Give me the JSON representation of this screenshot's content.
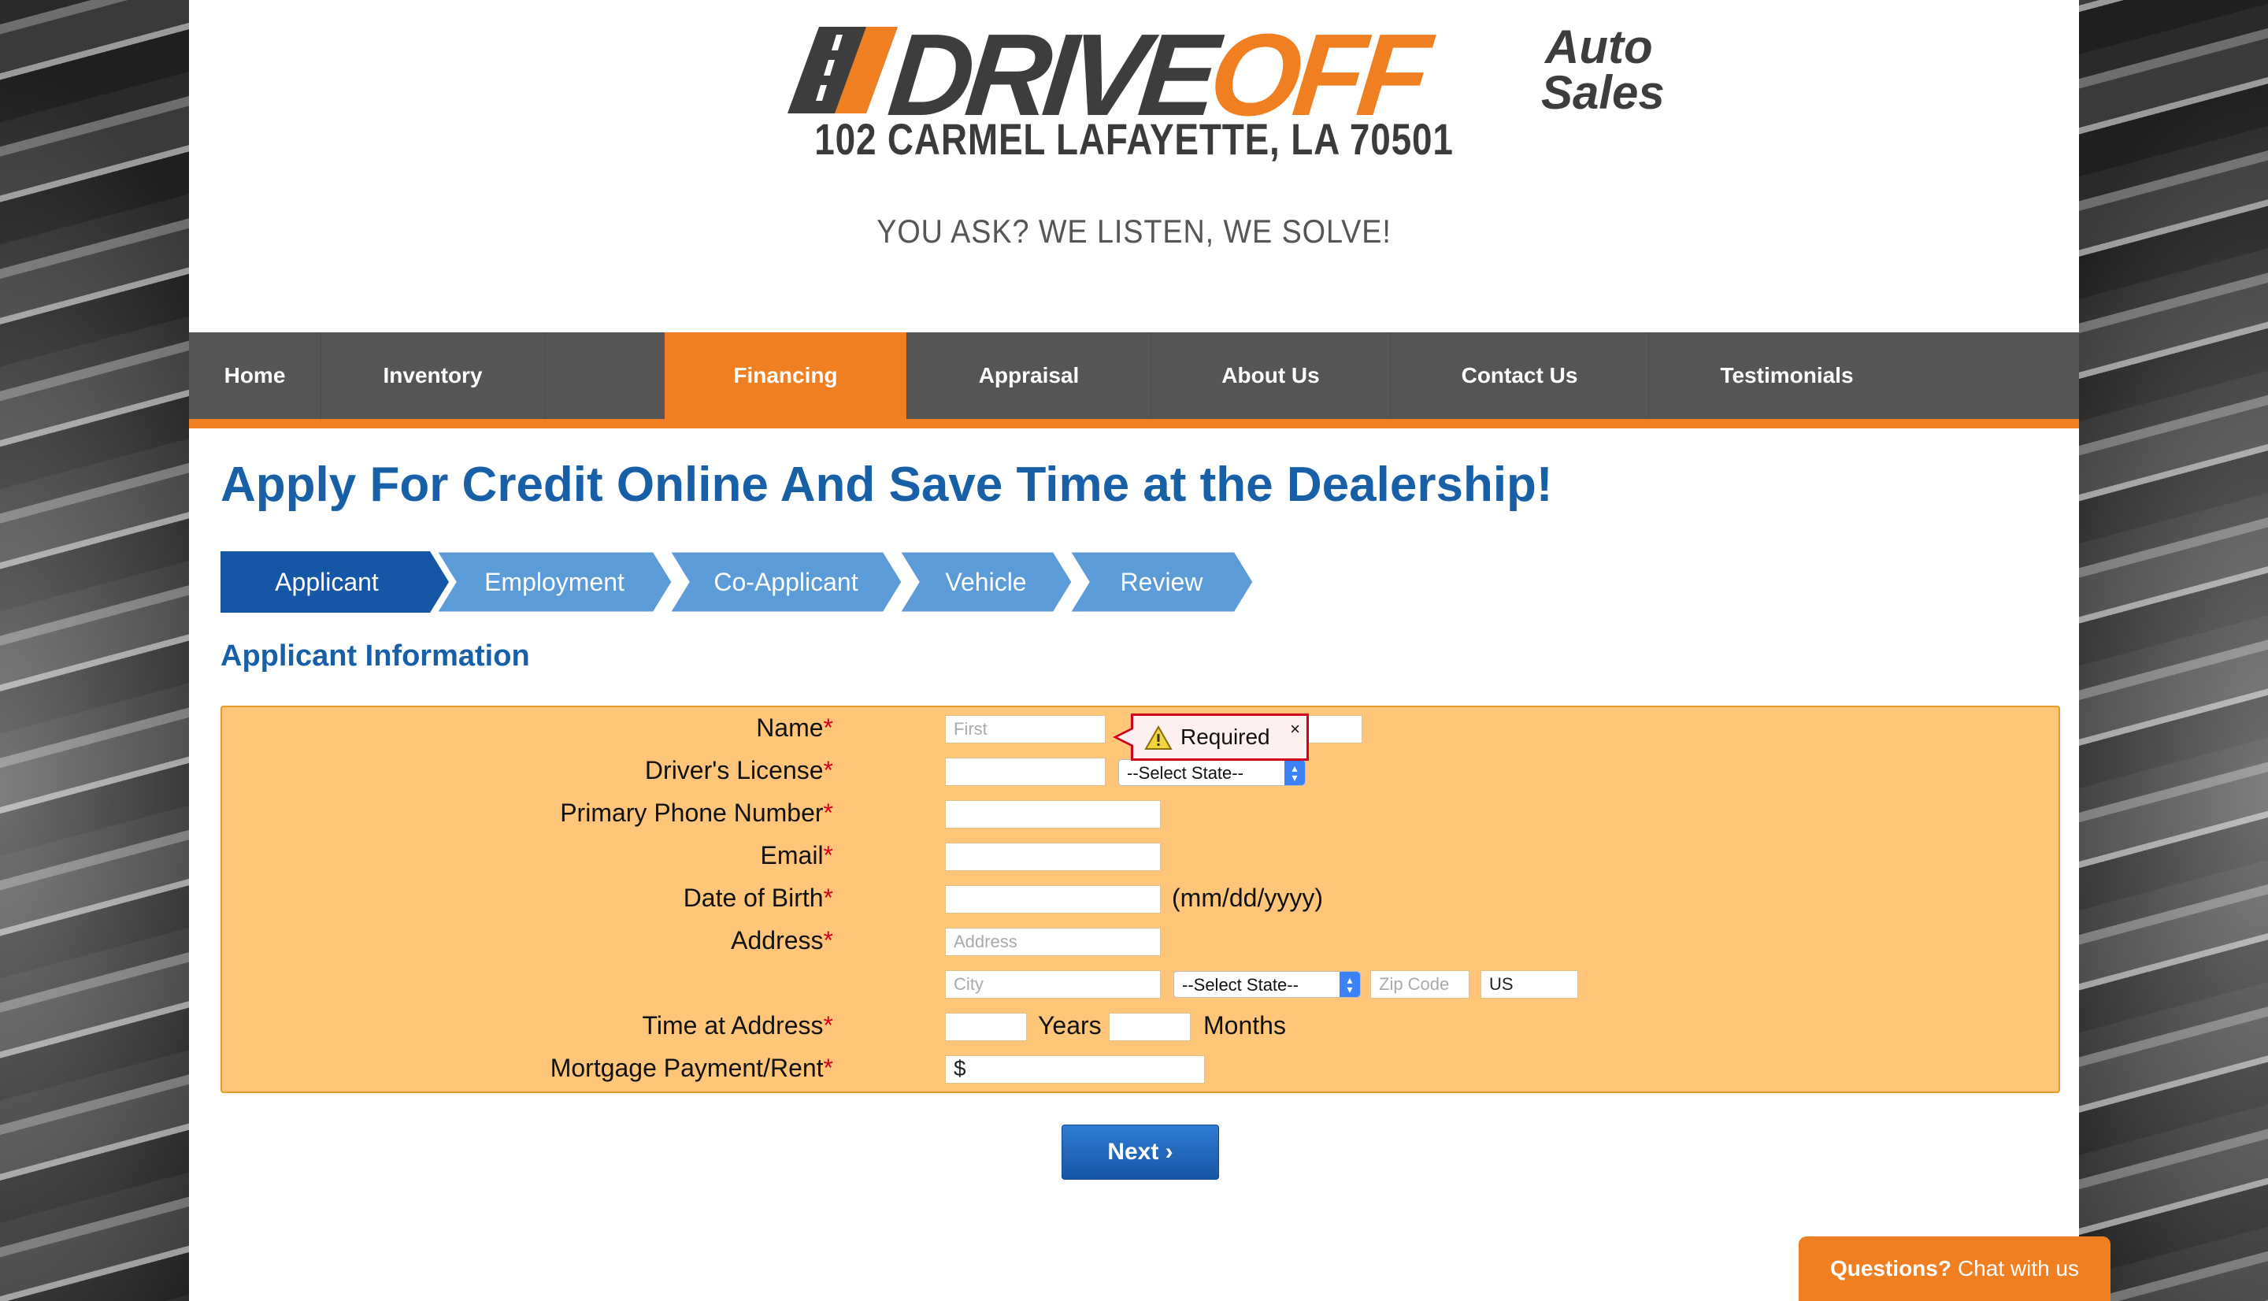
{
  "header": {
    "logo": {
      "brand_drive": "DRIVE",
      "brand_off": "OFF",
      "brand_auto": "Auto",
      "brand_sales": "Sales"
    },
    "address": "102 CARMEL LAFAYETTE, LA 70501",
    "tagline": "YOU ASK? WE LISTEN, WE SOLVE!"
  },
  "nav": {
    "items": [
      {
        "label": "Home"
      },
      {
        "label": "Inventory"
      },
      {
        "label": "Financing",
        "active": true
      },
      {
        "label": "Appraisal"
      },
      {
        "label": "About Us"
      },
      {
        "label": "Contact Us"
      },
      {
        "label": "Testimonials"
      }
    ]
  },
  "main": {
    "title": "Apply For Credit Online And Save Time at the Dealership!",
    "steps": [
      "Applicant",
      "Employment",
      "Co-Applicant",
      "Vehicle",
      "Review"
    ],
    "active_step": "Applicant",
    "section_title": "Applicant Information"
  },
  "form": {
    "required_mark": "*",
    "labels": {
      "name": "Name",
      "drivers_license": "Driver's License",
      "phone": "Primary Phone Number",
      "email": "Email",
      "dob": "Date of Birth",
      "address": "Address",
      "time_at_address": "Time at Address",
      "mortgage": "Mortgage Payment/Rent"
    },
    "placeholders": {
      "first": "First",
      "address": "Address",
      "city": "City",
      "zip": "Zip Code"
    },
    "values": {
      "country": "US",
      "mortgage_prefix": "$"
    },
    "select_state": "--Select State--",
    "dob_hint": "(mm/dd/yyyy)",
    "years_label": "Years",
    "months_label": "Months",
    "tooltip": {
      "text": "Required",
      "close": "×"
    }
  },
  "next_button": "Next ›",
  "chat": {
    "bold": "Questions?",
    "text": "Chat with us"
  },
  "colors": {
    "accent": "#f07f22",
    "primary": "#1760a8",
    "nav_bg": "#555555",
    "panel_bg": "#ffc67a",
    "step_active": "#1656a6",
    "step_inactive": "#5b9bd8"
  }
}
